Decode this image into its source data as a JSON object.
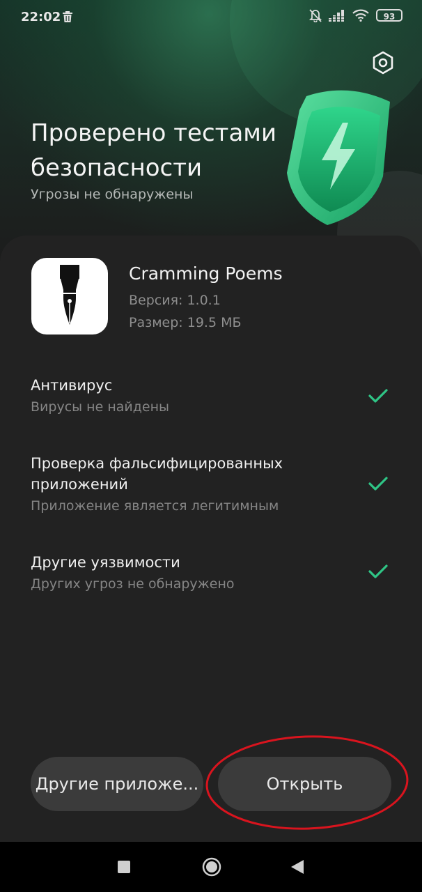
{
  "status_bar": {
    "time": "22:02",
    "battery": "93",
    "icons": [
      "trash-icon",
      "bell-off-icon",
      "signal-icon",
      "wifi-icon",
      "battery-icon"
    ]
  },
  "header": {
    "title": "Проверено тестами безопасности",
    "subtitle": "Угрозы не обнаружены",
    "settings_icon": "settings-icon",
    "shield_icon": "shield-lightning-icon"
  },
  "app": {
    "name": "Cramming Poems",
    "version": "Версия: 1.0.1",
    "size": "Размер: 19.5 МБ",
    "icon": "fountain-pen-icon"
  },
  "checks": [
    {
      "title": "Антивирус",
      "desc": "Вирусы не найдены",
      "status": "passed"
    },
    {
      "title": "Проверка фальсифицированных приложений",
      "desc": "Приложение является легитимным",
      "status": "passed"
    },
    {
      "title": "Другие уязвимости",
      "desc": "Других угроз не обнаружено",
      "status": "passed"
    }
  ],
  "buttons": {
    "other": "Другие приложе...",
    "open": "Открыть"
  },
  "colors": {
    "accent": "#2fc586",
    "background": "#1c1c1c",
    "card": "#222222",
    "button": "#3b3b3b",
    "annotation": "#d9141e"
  },
  "nav": {
    "icons": [
      "recents-square-icon",
      "home-circle-icon",
      "back-triangle-icon"
    ]
  }
}
